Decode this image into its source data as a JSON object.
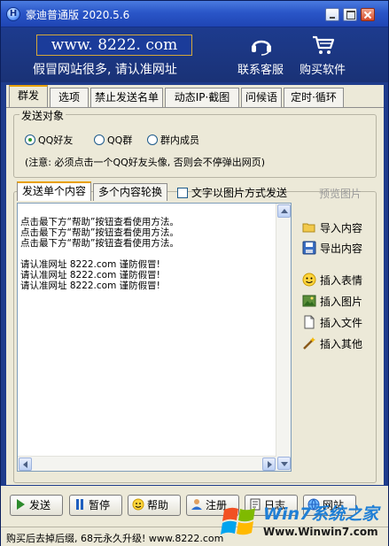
{
  "window": {
    "title": "豪迪普通版 2020.5.6",
    "app_icon_letter": "H"
  },
  "banner": {
    "url": "www. 8222. com",
    "slogan": "假冒网站很多, 请认准网址",
    "service_label": "联系客服",
    "buy_label": "购买软件"
  },
  "tabs": [
    {
      "label": "群发",
      "active": true
    },
    {
      "label": "选项"
    },
    {
      "label": "禁止发送名单"
    },
    {
      "label": "动态IP·截图"
    },
    {
      "label": "问候语"
    },
    {
      "label": "定时·循环"
    }
  ],
  "send_target": {
    "title": "发送对象",
    "options": [
      {
        "label": "QQ好友",
        "selected": true
      },
      {
        "label": "QQ群",
        "selected": false
      },
      {
        "label": "群内成员",
        "selected": false
      }
    ],
    "note": "(注意: 必须点击一个QQ好友头像, 否则会不停弹出网页)"
  },
  "content": {
    "subtabs": [
      {
        "label": "发送单个内容",
        "active": true
      },
      {
        "label": "多个内容轮换"
      }
    ],
    "image_mode_label": "文字以图片方式发送",
    "preview_label": "预览图片",
    "lines": [
      "点击最下方“帮助”按钮查看使用方法。",
      "点击最下方“帮助”按钮查看使用方法。",
      "点击最下方“帮助”按钮查看使用方法。",
      "",
      "请认准网址 8222.com 谨防假冒!",
      "请认准网址 8222.com 谨防假冒!",
      "请认准网址 8222.com 谨防假冒!"
    ]
  },
  "side_buttons": {
    "import": "导入内容",
    "export": "导出内容",
    "emoji": "插入表情",
    "image": "插入图片",
    "file": "插入文件",
    "other": "插入其他"
  },
  "bottom_buttons": {
    "send": "发送",
    "pause": "暂停",
    "help": "帮助",
    "register": "注册",
    "log": "日志",
    "website": "网站"
  },
  "status": "购买后去掉后缀, 68元永久升级! www.8222.com",
  "watermark": {
    "title": "Win7系统之家",
    "url": "Www.Winwin7.com"
  },
  "colors": {
    "banner": "#1d3b8e",
    "titlebar": "#2a56c8",
    "panel": "#ece9d8",
    "tab_accent": "#e8a000"
  }
}
